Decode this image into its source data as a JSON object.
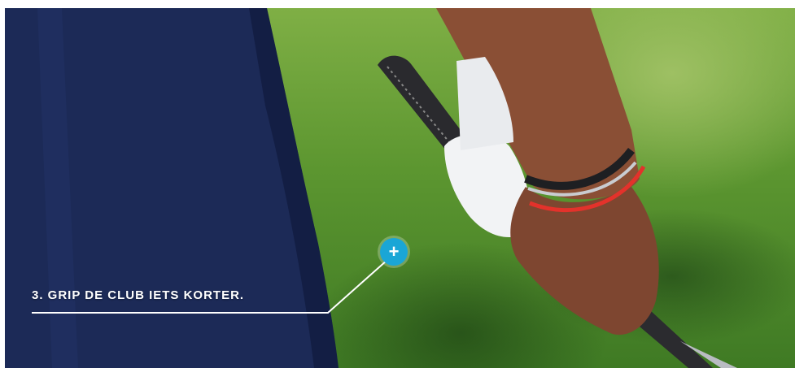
{
  "hotspot": {
    "caption": "3. GRIP DE CLUB IETS KORTER.",
    "icon": "plus-icon",
    "accent_color": "#1aa6d6",
    "line_color": "#ffffff"
  }
}
